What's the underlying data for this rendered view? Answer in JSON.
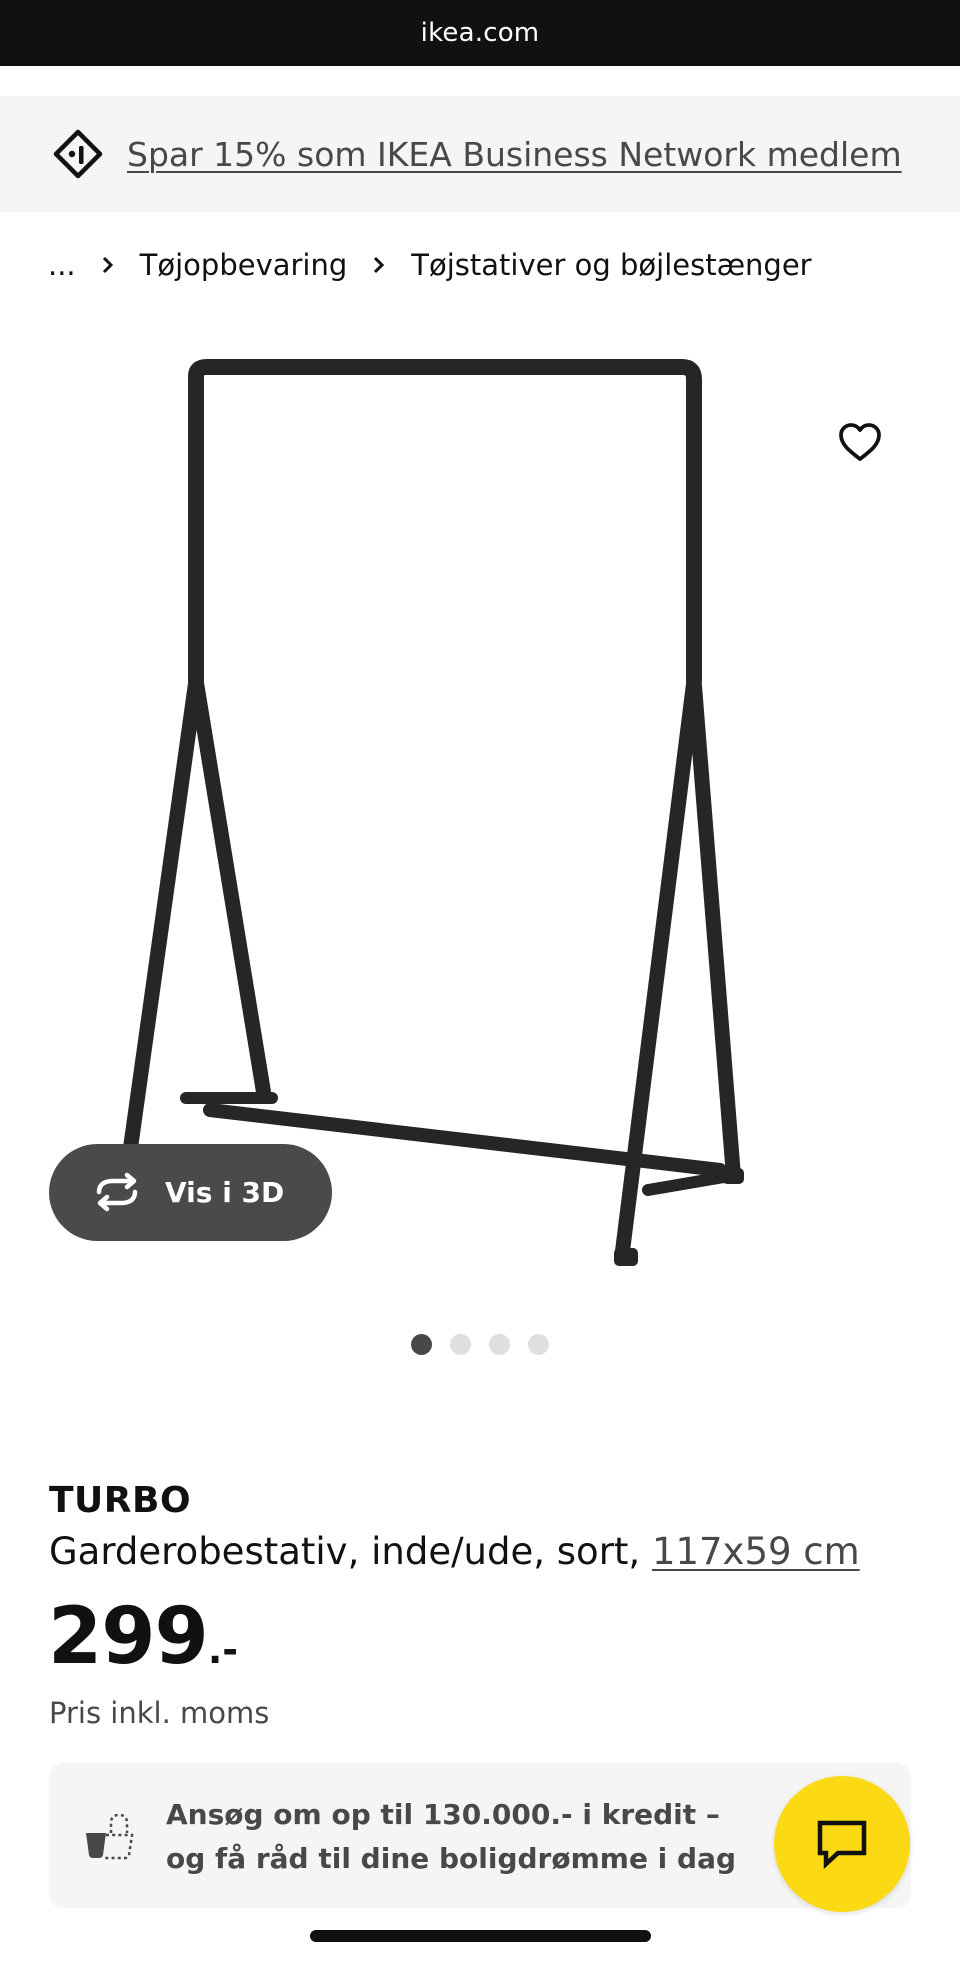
{
  "browser": {
    "url": "ikea.com"
  },
  "promo": {
    "text": "Spar 15% som IKEA Business Network medlem",
    "icon": "price-tag-icon"
  },
  "breadcrumb": {
    "items": [
      "...",
      "Tøjopbevaring",
      "Tøjstativer og bøjlestænger"
    ]
  },
  "gallery": {
    "view_3d_label": "Vis i 3D",
    "image_count": 4,
    "active_index": 0,
    "favorite_icon": "heart-icon"
  },
  "product": {
    "name": "TURBO",
    "description": "Garderobestativ, inde/ude, sort, ",
    "dimensions": "117x59 cm",
    "price_integer": "299",
    "price_suffix": ".-",
    "price_note": "Pris inkl. moms"
  },
  "credit": {
    "text": "Ansøg om op til 130.000.- i kredit – og få råd til dine boligdrømme i dag",
    "icon": "credit-bag-icon"
  },
  "chat": {
    "icon": "chat-bubble-icon",
    "color": "#fbd914"
  },
  "colors": {
    "url_bar": "#111111",
    "promo_bg": "#f5f5f5",
    "button_dark": "#4a4a4a",
    "text_secondary": "#484848"
  }
}
